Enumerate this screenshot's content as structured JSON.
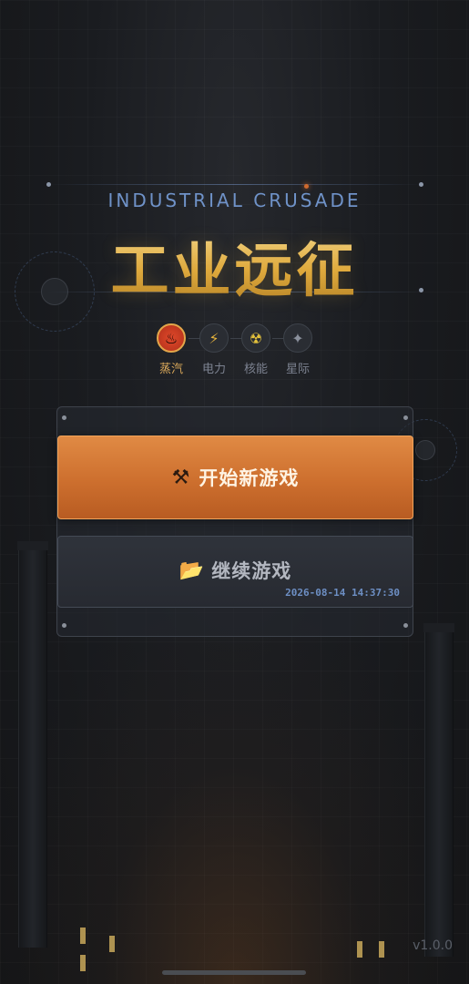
{
  "header": {
    "subtitle": "INDUSTRIAL CRUSADE",
    "title": "工业远征"
  },
  "eras": [
    {
      "label": "蒸汽",
      "icon": "steam-icon",
      "glyph": "♨",
      "active": true
    },
    {
      "label": "电力",
      "icon": "lightning-icon",
      "glyph": "⚡",
      "active": false
    },
    {
      "label": "核能",
      "icon": "radiation-icon",
      "glyph": "☢",
      "active": false
    },
    {
      "label": "星际",
      "icon": "star-icon",
      "glyph": "✦",
      "active": false
    }
  ],
  "menu": {
    "new_game": {
      "icon": "hammer-pick-icon",
      "glyph": "⚒",
      "label": "开始新游戏"
    },
    "continue_game": {
      "icon": "folder-icon",
      "glyph": "📂",
      "label": "继续游戏",
      "save_time": "2026-08-14 14:37:30"
    }
  },
  "footer": {
    "version": "v1.0.0"
  },
  "colors": {
    "accent_orange": "#cd6f2e",
    "title_gold": "#e3b44f",
    "subtitle_blue": "#6f92c8",
    "active_era": "#d9a85a"
  }
}
